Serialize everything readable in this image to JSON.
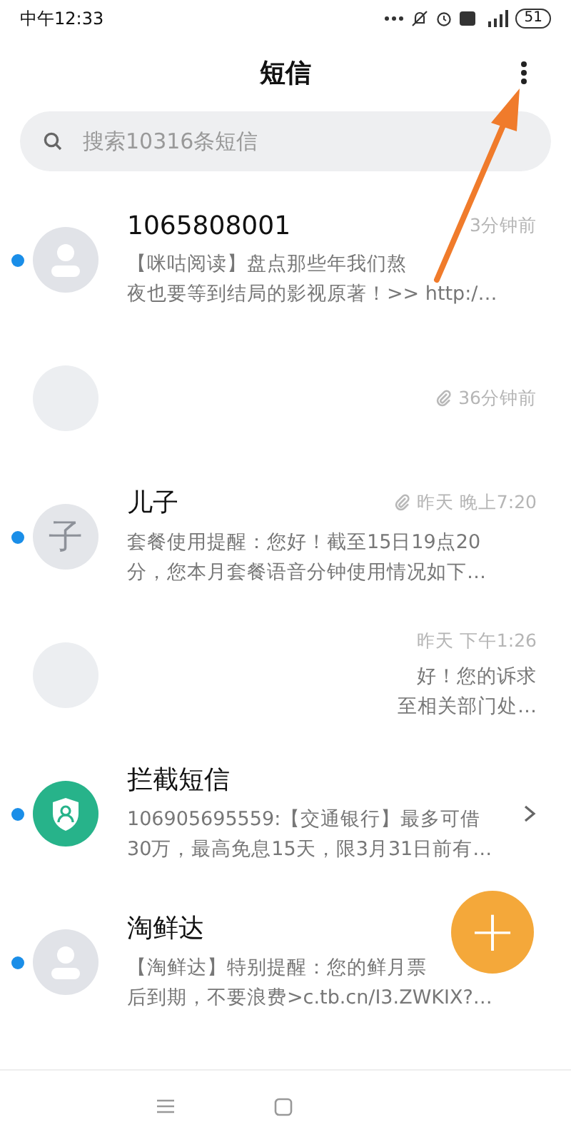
{
  "status_bar": {
    "time": "中午12:33",
    "battery": "51"
  },
  "header": {
    "title": "短信"
  },
  "search": {
    "placeholder": "搜索10316条短信"
  },
  "conversations": [
    {
      "kind": "person",
      "name": "1065808001",
      "time": "3分钟前",
      "attachment": false,
      "unread": true,
      "preview_lines": [
        "【咪咕阅读】盘点那些年我们熬",
        "夜也要等到结局的影视原著！>> http:/…"
      ]
    },
    {
      "kind": "blank",
      "time": "36分钟前",
      "attachment": true,
      "unread": false
    },
    {
      "kind": "letter",
      "avatar_text": "子",
      "name": "儿子",
      "time": "昨天 晚上7:20",
      "attachment": true,
      "unread": true,
      "preview_lines": [
        "套餐使用提醒：您好！截至15日19点20",
        "分，您本月套餐语音分钟使用情况如下…"
      ]
    },
    {
      "kind": "blank",
      "time": "昨天 下午1:26",
      "attachment": false,
      "unread": false,
      "preview_lines": [
        "好！您的诉求",
        "至相关部门处…"
      ]
    },
    {
      "kind": "shield",
      "name": "拦截短信",
      "unread": true,
      "chevron": true,
      "preview_lines": [
        "106905695559:【交通银行】最多可借",
        "30万，最高免息15天，限3月31日前有…"
      ]
    },
    {
      "kind": "person",
      "name": "淘鲜达",
      "unread": true,
      "preview_lines": [
        "【淘鲜达】特别提醒：您的鲜月票",
        "后到期，不要浪费>c.tb.cn/I3.ZWKIX?…"
      ]
    }
  ],
  "annotation_arrow": true,
  "compose_button": {
    "label": "+"
  }
}
